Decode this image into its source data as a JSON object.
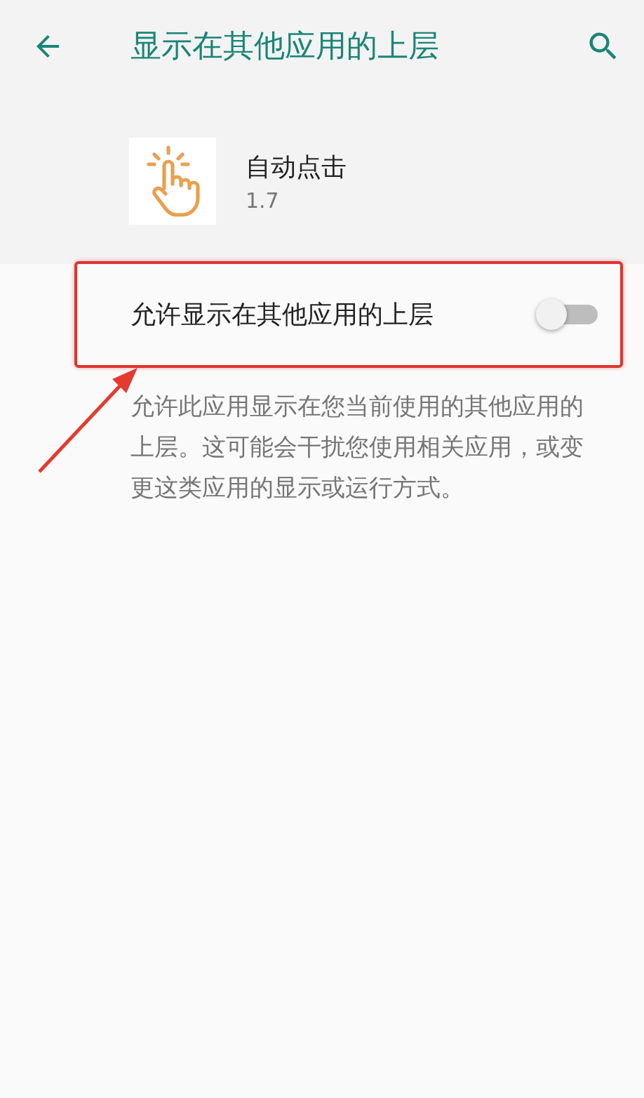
{
  "toolbar": {
    "title": "显示在其他应用的上层"
  },
  "app": {
    "name": "自动点击",
    "version": "1.7"
  },
  "toggle": {
    "label": "允许显示在其他应用的上层",
    "on": false
  },
  "description": "允许此应用显示在您当前使用的其他应用的上层。这可能会干扰您使用相关应用，或变更这类应用的显示或运行方式。"
}
